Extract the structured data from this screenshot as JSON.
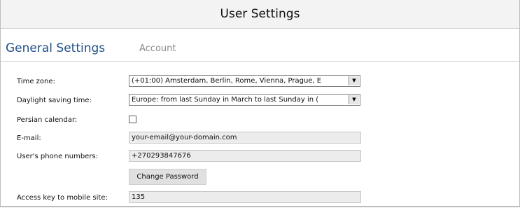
{
  "title": "User Settings",
  "tabs": {
    "general": "General Settings",
    "account": "Account"
  },
  "form": {
    "time_zone": {
      "label": "Time zone:",
      "value": "(+01:00) Amsterdam, Berlin, Rome, Vienna, Prague, E"
    },
    "dst": {
      "label": "Daylight saving time:",
      "value": "Europe: from last Sunday in March to last Sunday in ("
    },
    "persian": {
      "label": "Persian calendar:",
      "checked": false
    },
    "email": {
      "label": "E-mail:",
      "value": "your-email@your-domain.com"
    },
    "phone": {
      "label": "User's phone numbers:",
      "value": "+270293847676"
    },
    "change_password": {
      "label": "Change Password"
    },
    "access_key": {
      "label": "Access key to mobile site:",
      "value": "135"
    }
  },
  "icons": {
    "dropdown": "chevron-down-icon"
  }
}
